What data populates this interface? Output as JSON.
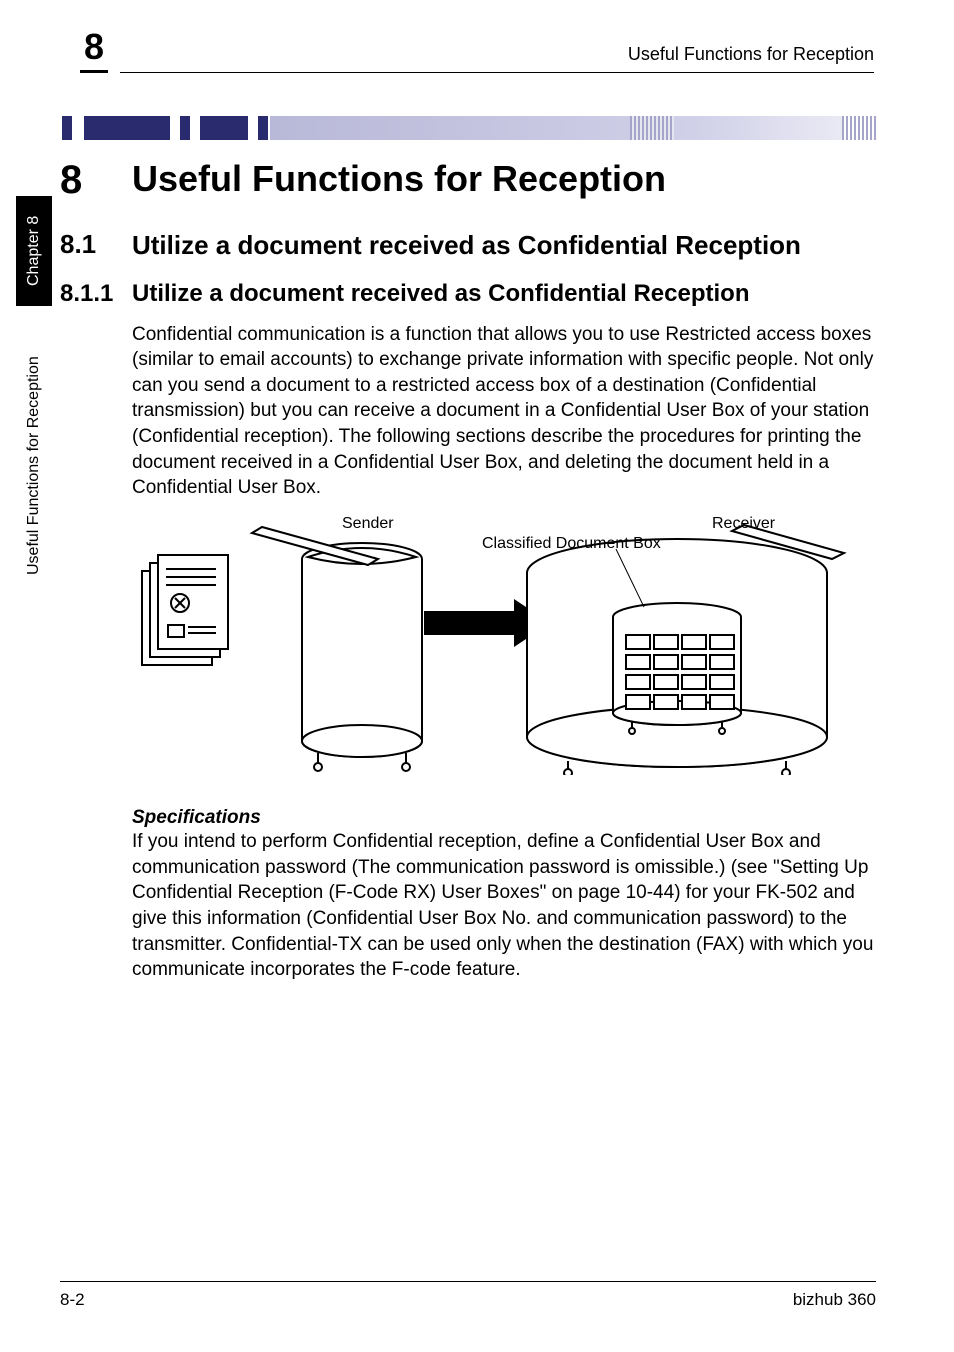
{
  "header": {
    "chapter_digit": "8",
    "running_title": "Useful Functions for Reception"
  },
  "sidetab": {
    "top": "Chapter 8",
    "bottom": "Useful Functions for Reception"
  },
  "h1": {
    "num": "8",
    "text": "Useful Functions for Reception"
  },
  "h2": {
    "num": "8.1",
    "text": "Utilize a document received as Confidential Reception"
  },
  "h3": {
    "num": "8.1.1",
    "text": "Utilize a document received as Confidential Reception"
  },
  "para1": "Confidential communication is a function that allows you to use Restricted access boxes (similar to email accounts) to exchange private information with specific people. Not only can you send a document to a restricted access box of a destination (Confidential transmission) but you can receive a document in a Confidential User Box of your station (Confidential reception). The following sections describe the procedures for printing the document received in a Confidential User Box, and deleting the document held in a Confidential User Box.",
  "diagram": {
    "sender": "Sender",
    "receiver": "Receiver",
    "classified": "Classified Document Box"
  },
  "spec_heading": "Specifications",
  "para2": "If you intend to perform Confidential reception, define a Confidential User Box and communication password (The communication password is omissible.) (see \"Setting Up Confidential Reception (F-Code RX) User Boxes\" on page 10-44) for your FK-502 and give this information (Confidential User Box No. and communication password) to the transmitter. Confidential-TX can be used only when the destination (FAX) with which you communicate incorporates the F-code feature.",
  "footer": {
    "left": "8-2",
    "right": "bizhub 360"
  }
}
